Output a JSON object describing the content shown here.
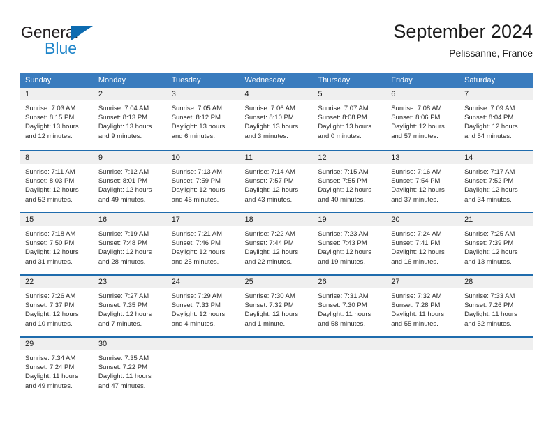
{
  "brand": {
    "name_top": "General",
    "name_bottom": "Blue",
    "triangle_color": "#0d6bb0",
    "blue_color": "#1d84c9"
  },
  "header": {
    "title": "September 2024",
    "location": "Pelissanne, France"
  },
  "theme": {
    "header_blue": "#3a7cbe",
    "rule_blue": "#1f6cad",
    "date_band": "#efefef"
  },
  "calendar": {
    "weekday_headers": [
      "Sunday",
      "Monday",
      "Tuesday",
      "Wednesday",
      "Thursday",
      "Friday",
      "Saturday"
    ],
    "weeks": [
      [
        {
          "day": "1",
          "sunrise": "Sunrise: 7:03 AM",
          "sunset": "Sunset: 8:15 PM",
          "daylight_1": "Daylight: 13 hours",
          "daylight_2": "and 12 minutes."
        },
        {
          "day": "2",
          "sunrise": "Sunrise: 7:04 AM",
          "sunset": "Sunset: 8:13 PM",
          "daylight_1": "Daylight: 13 hours",
          "daylight_2": "and 9 minutes."
        },
        {
          "day": "3",
          "sunrise": "Sunrise: 7:05 AM",
          "sunset": "Sunset: 8:12 PM",
          "daylight_1": "Daylight: 13 hours",
          "daylight_2": "and 6 minutes."
        },
        {
          "day": "4",
          "sunrise": "Sunrise: 7:06 AM",
          "sunset": "Sunset: 8:10 PM",
          "daylight_1": "Daylight: 13 hours",
          "daylight_2": "and 3 minutes."
        },
        {
          "day": "5",
          "sunrise": "Sunrise: 7:07 AM",
          "sunset": "Sunset: 8:08 PM",
          "daylight_1": "Daylight: 13 hours",
          "daylight_2": "and 0 minutes."
        },
        {
          "day": "6",
          "sunrise": "Sunrise: 7:08 AM",
          "sunset": "Sunset: 8:06 PM",
          "daylight_1": "Daylight: 12 hours",
          "daylight_2": "and 57 minutes."
        },
        {
          "day": "7",
          "sunrise": "Sunrise: 7:09 AM",
          "sunset": "Sunset: 8:04 PM",
          "daylight_1": "Daylight: 12 hours",
          "daylight_2": "and 54 minutes."
        }
      ],
      [
        {
          "day": "8",
          "sunrise": "Sunrise: 7:11 AM",
          "sunset": "Sunset: 8:03 PM",
          "daylight_1": "Daylight: 12 hours",
          "daylight_2": "and 52 minutes."
        },
        {
          "day": "9",
          "sunrise": "Sunrise: 7:12 AM",
          "sunset": "Sunset: 8:01 PM",
          "daylight_1": "Daylight: 12 hours",
          "daylight_2": "and 49 minutes."
        },
        {
          "day": "10",
          "sunrise": "Sunrise: 7:13 AM",
          "sunset": "Sunset: 7:59 PM",
          "daylight_1": "Daylight: 12 hours",
          "daylight_2": "and 46 minutes."
        },
        {
          "day": "11",
          "sunrise": "Sunrise: 7:14 AM",
          "sunset": "Sunset: 7:57 PM",
          "daylight_1": "Daylight: 12 hours",
          "daylight_2": "and 43 minutes."
        },
        {
          "day": "12",
          "sunrise": "Sunrise: 7:15 AM",
          "sunset": "Sunset: 7:55 PM",
          "daylight_1": "Daylight: 12 hours",
          "daylight_2": "and 40 minutes."
        },
        {
          "day": "13",
          "sunrise": "Sunrise: 7:16 AM",
          "sunset": "Sunset: 7:54 PM",
          "daylight_1": "Daylight: 12 hours",
          "daylight_2": "and 37 minutes."
        },
        {
          "day": "14",
          "sunrise": "Sunrise: 7:17 AM",
          "sunset": "Sunset: 7:52 PM",
          "daylight_1": "Daylight: 12 hours",
          "daylight_2": "and 34 minutes."
        }
      ],
      [
        {
          "day": "15",
          "sunrise": "Sunrise: 7:18 AM",
          "sunset": "Sunset: 7:50 PM",
          "daylight_1": "Daylight: 12 hours",
          "daylight_2": "and 31 minutes."
        },
        {
          "day": "16",
          "sunrise": "Sunrise: 7:19 AM",
          "sunset": "Sunset: 7:48 PM",
          "daylight_1": "Daylight: 12 hours",
          "daylight_2": "and 28 minutes."
        },
        {
          "day": "17",
          "sunrise": "Sunrise: 7:21 AM",
          "sunset": "Sunset: 7:46 PM",
          "daylight_1": "Daylight: 12 hours",
          "daylight_2": "and 25 minutes."
        },
        {
          "day": "18",
          "sunrise": "Sunrise: 7:22 AM",
          "sunset": "Sunset: 7:44 PM",
          "daylight_1": "Daylight: 12 hours",
          "daylight_2": "and 22 minutes."
        },
        {
          "day": "19",
          "sunrise": "Sunrise: 7:23 AM",
          "sunset": "Sunset: 7:43 PM",
          "daylight_1": "Daylight: 12 hours",
          "daylight_2": "and 19 minutes."
        },
        {
          "day": "20",
          "sunrise": "Sunrise: 7:24 AM",
          "sunset": "Sunset: 7:41 PM",
          "daylight_1": "Daylight: 12 hours",
          "daylight_2": "and 16 minutes."
        },
        {
          "day": "21",
          "sunrise": "Sunrise: 7:25 AM",
          "sunset": "Sunset: 7:39 PM",
          "daylight_1": "Daylight: 12 hours",
          "daylight_2": "and 13 minutes."
        }
      ],
      [
        {
          "day": "22",
          "sunrise": "Sunrise: 7:26 AM",
          "sunset": "Sunset: 7:37 PM",
          "daylight_1": "Daylight: 12 hours",
          "daylight_2": "and 10 minutes."
        },
        {
          "day": "23",
          "sunrise": "Sunrise: 7:27 AM",
          "sunset": "Sunset: 7:35 PM",
          "daylight_1": "Daylight: 12 hours",
          "daylight_2": "and 7 minutes."
        },
        {
          "day": "24",
          "sunrise": "Sunrise: 7:29 AM",
          "sunset": "Sunset: 7:33 PM",
          "daylight_1": "Daylight: 12 hours",
          "daylight_2": "and 4 minutes."
        },
        {
          "day": "25",
          "sunrise": "Sunrise: 7:30 AM",
          "sunset": "Sunset: 7:32 PM",
          "daylight_1": "Daylight: 12 hours",
          "daylight_2": "and 1 minute."
        },
        {
          "day": "26",
          "sunrise": "Sunrise: 7:31 AM",
          "sunset": "Sunset: 7:30 PM",
          "daylight_1": "Daylight: 11 hours",
          "daylight_2": "and 58 minutes."
        },
        {
          "day": "27",
          "sunrise": "Sunrise: 7:32 AM",
          "sunset": "Sunset: 7:28 PM",
          "daylight_1": "Daylight: 11 hours",
          "daylight_2": "and 55 minutes."
        },
        {
          "day": "28",
          "sunrise": "Sunrise: 7:33 AM",
          "sunset": "Sunset: 7:26 PM",
          "daylight_1": "Daylight: 11 hours",
          "daylight_2": "and 52 minutes."
        }
      ],
      [
        {
          "day": "29",
          "sunrise": "Sunrise: 7:34 AM",
          "sunset": "Sunset: 7:24 PM",
          "daylight_1": "Daylight: 11 hours",
          "daylight_2": "and 49 minutes."
        },
        {
          "day": "30",
          "sunrise": "Sunrise: 7:35 AM",
          "sunset": "Sunset: 7:22 PM",
          "daylight_1": "Daylight: 11 hours",
          "daylight_2": "and 47 minutes."
        },
        {
          "day": "",
          "sunrise": "",
          "sunset": "",
          "daylight_1": "",
          "daylight_2": ""
        },
        {
          "day": "",
          "sunrise": "",
          "sunset": "",
          "daylight_1": "",
          "daylight_2": ""
        },
        {
          "day": "",
          "sunrise": "",
          "sunset": "",
          "daylight_1": "",
          "daylight_2": ""
        },
        {
          "day": "",
          "sunrise": "",
          "sunset": "",
          "daylight_1": "",
          "daylight_2": ""
        },
        {
          "day": "",
          "sunrise": "",
          "sunset": "",
          "daylight_1": "",
          "daylight_2": ""
        }
      ]
    ]
  }
}
